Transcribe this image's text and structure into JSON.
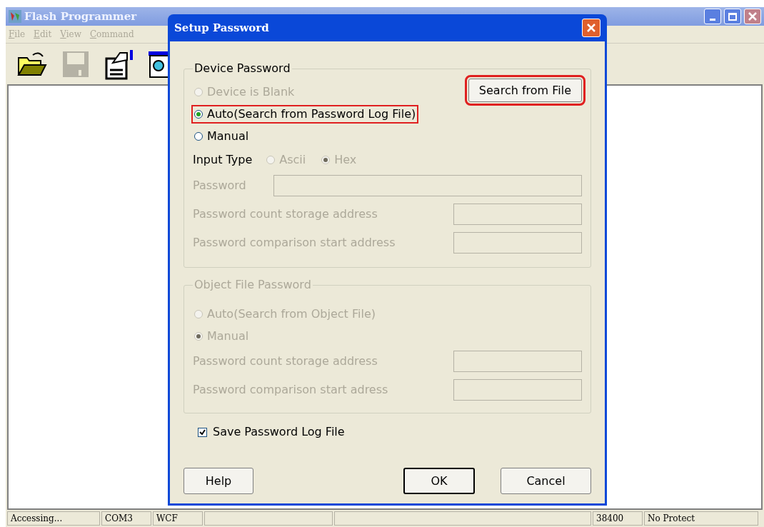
{
  "main_window": {
    "title": "Flash Programmer",
    "menu": [
      "File",
      "Edit",
      "View",
      "Command"
    ],
    "status_bar": [
      {
        "text": "Accessing..."
      },
      {
        "text": "COM3"
      },
      {
        "text": "WCF"
      },
      {
        "text": "38400"
      },
      {
        "text": "No Protect"
      }
    ]
  },
  "dialog": {
    "title": "Setup Password",
    "device_password": {
      "legend": "Device Password",
      "search_button": {
        "label": "Search from File",
        "highlighted": true
      },
      "options": [
        {
          "label": "Device is Blank",
          "selected": false,
          "disabled": true,
          "highlighted": false
        },
        {
          "label": "Auto(Search from Password Log File)",
          "selected": true,
          "disabled": false,
          "highlighted": true
        },
        {
          "label": "Manual",
          "selected": false,
          "disabled": false,
          "highlighted": false
        }
      ],
      "input_type": {
        "label": "Input Type",
        "options": [
          {
            "label": "Ascii",
            "selected": false,
            "disabled": true
          },
          {
            "label": "Hex",
            "selected": true,
            "disabled": true
          }
        ]
      },
      "fields": [
        {
          "label": "Password",
          "kind": "wide",
          "disabled": true
        },
        {
          "label": "Password count storage address",
          "kind": "narrow",
          "disabled": true
        },
        {
          "label": "Password comparison start address",
          "kind": "narrow",
          "disabled": true
        }
      ]
    },
    "object_file_password": {
      "legend": "Object File Password",
      "disabled": true,
      "options": [
        {
          "label": "Auto(Search from Object File)",
          "selected": false,
          "disabled": true
        },
        {
          "label": "Manual",
          "selected": true,
          "disabled": true
        }
      ],
      "fields": [
        {
          "label": "Password count storage address",
          "disabled": true
        },
        {
          "label": "Password comparison start adress",
          "disabled": true
        }
      ]
    },
    "save_log": {
      "label": "Save Password Log File",
      "checked": true
    },
    "buttons": [
      {
        "label": "Help",
        "default": false
      },
      {
        "label": "OK",
        "default": true
      },
      {
        "label": "Cancel",
        "default": false
      }
    ]
  }
}
